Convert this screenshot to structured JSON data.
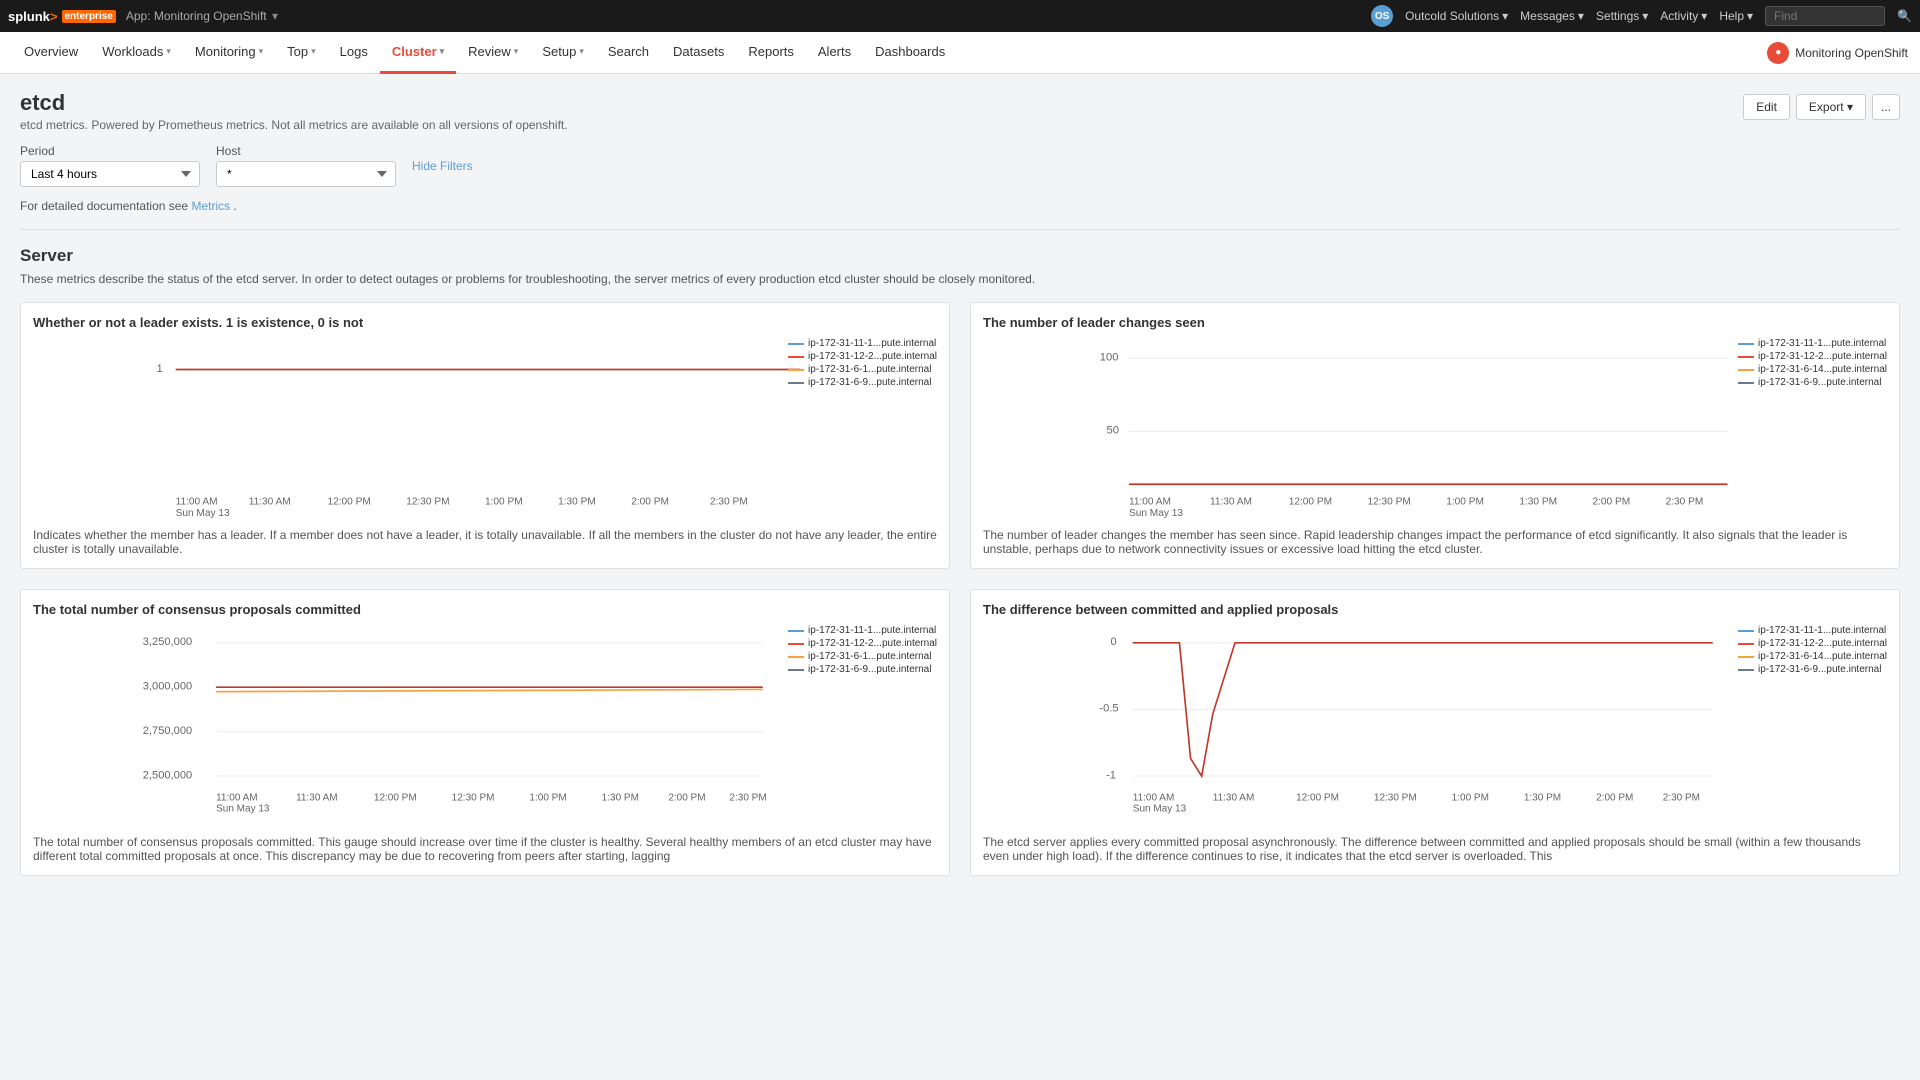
{
  "topbar": {
    "splunk": "splunk",
    "enterprise_label": "enterprise",
    "app_label": "App: Monitoring OpenShift",
    "user": "Outcold Solutions",
    "messages_label": "Messages",
    "settings_label": "Settings",
    "activity_label": "Activity",
    "help_label": "Help",
    "find_placeholder": "Find",
    "monitoring_label": "Monitoring OpenShift"
  },
  "navbar": {
    "items": [
      {
        "label": "Overview",
        "active": false
      },
      {
        "label": "Workloads",
        "active": false,
        "dropdown": true
      },
      {
        "label": "Monitoring",
        "active": false,
        "dropdown": true
      },
      {
        "label": "Top",
        "active": false,
        "dropdown": true
      },
      {
        "label": "Logs",
        "active": false
      },
      {
        "label": "Cluster",
        "active": true,
        "dropdown": true
      },
      {
        "label": "Review",
        "active": false,
        "dropdown": true
      },
      {
        "label": "Setup",
        "active": false,
        "dropdown": true
      },
      {
        "label": "Search",
        "active": false
      },
      {
        "label": "Datasets",
        "active": false
      },
      {
        "label": "Reports",
        "active": false
      },
      {
        "label": "Alerts",
        "active": false
      },
      {
        "label": "Dashboards",
        "active": false
      }
    ]
  },
  "page": {
    "title": "etcd",
    "subtitle": "etcd metrics. Powered by Prometheus metrics. Not all metrics are available on all versions of openshift.",
    "actions": {
      "edit": "Edit",
      "export": "Export",
      "more": "..."
    },
    "filters": {
      "period_label": "Period",
      "period_value": "Last 4 hours",
      "host_label": "Host",
      "host_value": "*",
      "hide_filters": "Hide Filters"
    },
    "doc_line": "For detailed documentation see",
    "doc_link": "Metrics",
    "doc_end": ".",
    "server_section": {
      "title": "Server",
      "desc": "These metrics describe the status of the etcd server. In order to detect outages or problems for troubleshooting, the server metrics of every production etcd cluster should be closely monitored."
    },
    "chart1": {
      "title": "Whether or not a leader exists. 1 is existence, 0 is not",
      "y_values": [
        "1"
      ],
      "x_labels": [
        "11:00 AM\nSun May 13\n2018",
        "11:30 AM",
        "12:00 PM",
        "12:30 PM",
        "1:00 PM",
        "1:30 PM",
        "2:00 PM",
        "2:30 PM"
      ],
      "legend": [
        {
          "label": "ip-172-31-11-1...pute.internal",
          "color": "#5a9fd4"
        },
        {
          "label": "ip-172-31-12-2...pute.internal",
          "color": "#e84b37"
        },
        {
          "label": "ip-172-31-6-1...pute.internal",
          "color": "#f8a23b"
        },
        {
          "label": "ip-172-31-6-9...pute.internal",
          "color": "#6c7a89"
        }
      ],
      "desc": "Indicates whether the member has a leader. If a member does not have a leader, it is totally unavailable. If all the members in the cluster do not have any leader, the entire cluster is totally unavailable."
    },
    "chart2": {
      "title": "The number of leader changes seen",
      "y_values": [
        "100",
        "50"
      ],
      "x_labels": [
        "11:00 AM\nSun May 13\n2018",
        "11:30 AM",
        "12:00 PM",
        "12:30 PM",
        "1:00 PM",
        "1:30 PM",
        "2:00 PM",
        "2:30 PM"
      ],
      "legend": [
        {
          "label": "ip-172-31-11-1...pute.internal",
          "color": "#5a9fd4"
        },
        {
          "label": "ip-172-31-12-2...pute.internal",
          "color": "#e84b37"
        },
        {
          "label": "ip-172-31-6-14...pute.internal",
          "color": "#f8a23b"
        },
        {
          "label": "ip-172-31-6-9...pute.internal",
          "color": "#6c7a89"
        }
      ],
      "desc": "The number of leader changes the member has seen since. Rapid leadership changes impact the performance of etcd significantly. It also signals that the leader is unstable, perhaps due to network connectivity issues or excessive load hitting the etcd cluster."
    },
    "chart3": {
      "title": "The total number of consensus proposals committed",
      "y_values": [
        "3,250,000",
        "3,000,000",
        "2,750,000",
        "2,500,000"
      ],
      "x_labels": [
        "11:00 AM\nSun May 13\n2018",
        "11:30 AM",
        "12:00 PM",
        "12:30 PM",
        "1:00 PM",
        "1:30 PM",
        "2:00 PM",
        "2:30 PM"
      ],
      "legend": [
        {
          "label": "ip-172-31-11-1...pute.internal",
          "color": "#5a9fd4"
        },
        {
          "label": "ip-172-31-12-2...pute.internal",
          "color": "#e84b37"
        },
        {
          "label": "ip-172-31-6-1...pute.internal",
          "color": "#f8a23b"
        },
        {
          "label": "ip-172-31-6-9...pute.internal",
          "color": "#6c7a89"
        }
      ],
      "desc": "The total number of consensus proposals committed. This gauge should increase over time if the cluster is healthy. Several healthy members of an etcd cluster may have different total committed proposals at once. This discrepancy may be due to recovering from peers after starting, lagging"
    },
    "chart4": {
      "title": "The difference between committed and applied proposals",
      "y_values": [
        "0",
        "-0.5",
        "-1"
      ],
      "x_labels": [
        "11:00 AM\nSun May 13\n2018",
        "11:30 AM",
        "12:00 PM",
        "12:30 PM",
        "1:00 PM",
        "1:30 PM",
        "2:00 PM",
        "2:30 PM"
      ],
      "legend": [
        {
          "label": "ip-172-31-11-1...pute.internal",
          "color": "#5a9fd4"
        },
        {
          "label": "ip-172-31-12-2...pute.internal",
          "color": "#e84b37"
        },
        {
          "label": "ip-172-31-6-14...pute.internal",
          "color": "#f8a23b"
        },
        {
          "label": "ip-172-31-6-9...pute.internal",
          "color": "#6c7a89"
        }
      ],
      "desc": "The etcd server applies every committed proposal asynchronously. The difference between committed and applied proposals should be small (within a few thousands even under high load). If the difference continues to rise, it indicates that the etcd server is overloaded. This"
    }
  }
}
